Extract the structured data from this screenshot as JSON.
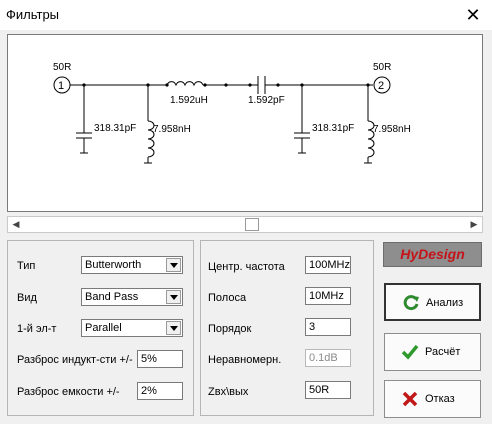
{
  "window": {
    "title": "Фильтры",
    "close": "✕"
  },
  "schematic": {
    "port1": {
      "impedance": "50R",
      "number": "1"
    },
    "port2": {
      "impedance": "50R",
      "number": "2"
    },
    "c_shunt1": "318.31pF",
    "l_shunt1": "7.958nH",
    "l_series": "1.592uH",
    "c_series": "1.592pF",
    "c_shunt2": "318.31pF",
    "l_shunt2": "7.958nH"
  },
  "scrollbar": {
    "left_arrow": "◀",
    "right_arrow": "▶"
  },
  "left_panel": {
    "type_label": "Тип",
    "type_value": "Butterworth",
    "kind_label": "Вид",
    "kind_value": "Band Pass",
    "first_label": "1-й эл-т",
    "first_value": "Parallel",
    "l_spread_label": "Разброс индукт-сти +/-",
    "l_spread_value": "5%",
    "c_spread_label": "Разброс емкости +/-",
    "c_spread_value": "2%"
  },
  "mid_panel": {
    "center_label": "Центр. частота",
    "center_value": "100MHz",
    "band_label": "Полоса",
    "band_value": "10MHz",
    "order_label": "Порядок",
    "order_value": "3",
    "ripple_label": "Неравномерн.",
    "ripple_value": "0.1dB",
    "z_label": "Zвх\\вых",
    "z_value": "50R"
  },
  "logo": "HyDesign",
  "buttons": {
    "analyze": "Анализ",
    "calculate": "Расчёт",
    "cancel": "Отказ"
  },
  "colors": {
    "logo_text": "#c4141a",
    "analyze_icon": "#2e8b2e",
    "calc_icon": "#2e9a2e",
    "cancel_icon": "#c01818"
  }
}
